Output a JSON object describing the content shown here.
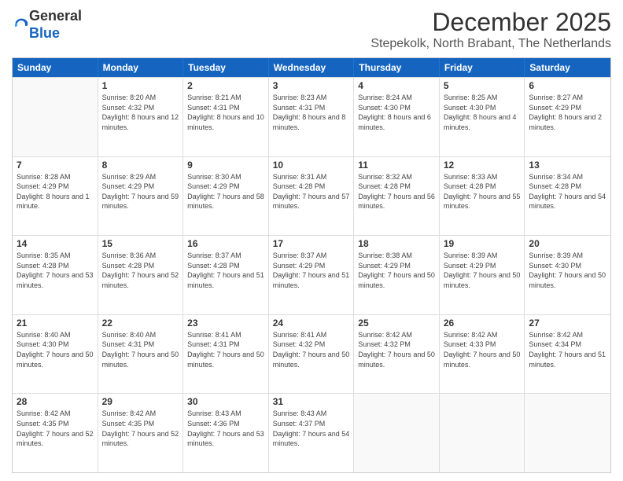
{
  "logo": {
    "general": "General",
    "blue": "Blue"
  },
  "header": {
    "month": "December 2025",
    "location": "Stepekolk, North Brabant, The Netherlands"
  },
  "weekdays": [
    "Sunday",
    "Monday",
    "Tuesday",
    "Wednesday",
    "Thursday",
    "Friday",
    "Saturday"
  ],
  "weeks": [
    [
      {
        "day": "",
        "empty": true
      },
      {
        "day": "1",
        "sunrise": "Sunrise: 8:20 AM",
        "sunset": "Sunset: 4:32 PM",
        "daylight": "Daylight: 8 hours and 12 minutes."
      },
      {
        "day": "2",
        "sunrise": "Sunrise: 8:21 AM",
        "sunset": "Sunset: 4:31 PM",
        "daylight": "Daylight: 8 hours and 10 minutes."
      },
      {
        "day": "3",
        "sunrise": "Sunrise: 8:23 AM",
        "sunset": "Sunset: 4:31 PM",
        "daylight": "Daylight: 8 hours and 8 minutes."
      },
      {
        "day": "4",
        "sunrise": "Sunrise: 8:24 AM",
        "sunset": "Sunset: 4:30 PM",
        "daylight": "Daylight: 8 hours and 6 minutes."
      },
      {
        "day": "5",
        "sunrise": "Sunrise: 8:25 AM",
        "sunset": "Sunset: 4:30 PM",
        "daylight": "Daylight: 8 hours and 4 minutes."
      },
      {
        "day": "6",
        "sunrise": "Sunrise: 8:27 AM",
        "sunset": "Sunset: 4:29 PM",
        "daylight": "Daylight: 8 hours and 2 minutes."
      }
    ],
    [
      {
        "day": "7",
        "sunrise": "Sunrise: 8:28 AM",
        "sunset": "Sunset: 4:29 PM",
        "daylight": "Daylight: 8 hours and 1 minute."
      },
      {
        "day": "8",
        "sunrise": "Sunrise: 8:29 AM",
        "sunset": "Sunset: 4:29 PM",
        "daylight": "Daylight: 7 hours and 59 minutes."
      },
      {
        "day": "9",
        "sunrise": "Sunrise: 8:30 AM",
        "sunset": "Sunset: 4:29 PM",
        "daylight": "Daylight: 7 hours and 58 minutes."
      },
      {
        "day": "10",
        "sunrise": "Sunrise: 8:31 AM",
        "sunset": "Sunset: 4:28 PM",
        "daylight": "Daylight: 7 hours and 57 minutes."
      },
      {
        "day": "11",
        "sunrise": "Sunrise: 8:32 AM",
        "sunset": "Sunset: 4:28 PM",
        "daylight": "Daylight: 7 hours and 56 minutes."
      },
      {
        "day": "12",
        "sunrise": "Sunrise: 8:33 AM",
        "sunset": "Sunset: 4:28 PM",
        "daylight": "Daylight: 7 hours and 55 minutes."
      },
      {
        "day": "13",
        "sunrise": "Sunrise: 8:34 AM",
        "sunset": "Sunset: 4:28 PM",
        "daylight": "Daylight: 7 hours and 54 minutes."
      }
    ],
    [
      {
        "day": "14",
        "sunrise": "Sunrise: 8:35 AM",
        "sunset": "Sunset: 4:28 PM",
        "daylight": "Daylight: 7 hours and 53 minutes."
      },
      {
        "day": "15",
        "sunrise": "Sunrise: 8:36 AM",
        "sunset": "Sunset: 4:28 PM",
        "daylight": "Daylight: 7 hours and 52 minutes."
      },
      {
        "day": "16",
        "sunrise": "Sunrise: 8:37 AM",
        "sunset": "Sunset: 4:28 PM",
        "daylight": "Daylight: 7 hours and 51 minutes."
      },
      {
        "day": "17",
        "sunrise": "Sunrise: 8:37 AM",
        "sunset": "Sunset: 4:29 PM",
        "daylight": "Daylight: 7 hours and 51 minutes."
      },
      {
        "day": "18",
        "sunrise": "Sunrise: 8:38 AM",
        "sunset": "Sunset: 4:29 PM",
        "daylight": "Daylight: 7 hours and 50 minutes."
      },
      {
        "day": "19",
        "sunrise": "Sunrise: 8:39 AM",
        "sunset": "Sunset: 4:29 PM",
        "daylight": "Daylight: 7 hours and 50 minutes."
      },
      {
        "day": "20",
        "sunrise": "Sunrise: 8:39 AM",
        "sunset": "Sunset: 4:30 PM",
        "daylight": "Daylight: 7 hours and 50 minutes."
      }
    ],
    [
      {
        "day": "21",
        "sunrise": "Sunrise: 8:40 AM",
        "sunset": "Sunset: 4:30 PM",
        "daylight": "Daylight: 7 hours and 50 minutes."
      },
      {
        "day": "22",
        "sunrise": "Sunrise: 8:40 AM",
        "sunset": "Sunset: 4:31 PM",
        "daylight": "Daylight: 7 hours and 50 minutes."
      },
      {
        "day": "23",
        "sunrise": "Sunrise: 8:41 AM",
        "sunset": "Sunset: 4:31 PM",
        "daylight": "Daylight: 7 hours and 50 minutes."
      },
      {
        "day": "24",
        "sunrise": "Sunrise: 8:41 AM",
        "sunset": "Sunset: 4:32 PM",
        "daylight": "Daylight: 7 hours and 50 minutes."
      },
      {
        "day": "25",
        "sunrise": "Sunrise: 8:42 AM",
        "sunset": "Sunset: 4:32 PM",
        "daylight": "Daylight: 7 hours and 50 minutes."
      },
      {
        "day": "26",
        "sunrise": "Sunrise: 8:42 AM",
        "sunset": "Sunset: 4:33 PM",
        "daylight": "Daylight: 7 hours and 50 minutes."
      },
      {
        "day": "27",
        "sunrise": "Sunrise: 8:42 AM",
        "sunset": "Sunset: 4:34 PM",
        "daylight": "Daylight: 7 hours and 51 minutes."
      }
    ],
    [
      {
        "day": "28",
        "sunrise": "Sunrise: 8:42 AM",
        "sunset": "Sunset: 4:35 PM",
        "daylight": "Daylight: 7 hours and 52 minutes."
      },
      {
        "day": "29",
        "sunrise": "Sunrise: 8:42 AM",
        "sunset": "Sunset: 4:35 PM",
        "daylight": "Daylight: 7 hours and 52 minutes."
      },
      {
        "day": "30",
        "sunrise": "Sunrise: 8:43 AM",
        "sunset": "Sunset: 4:36 PM",
        "daylight": "Daylight: 7 hours and 53 minutes."
      },
      {
        "day": "31",
        "sunrise": "Sunrise: 8:43 AM",
        "sunset": "Sunset: 4:37 PM",
        "daylight": "Daylight: 7 hours and 54 minutes."
      },
      {
        "day": "",
        "empty": true
      },
      {
        "day": "",
        "empty": true
      },
      {
        "day": "",
        "empty": true
      }
    ]
  ]
}
